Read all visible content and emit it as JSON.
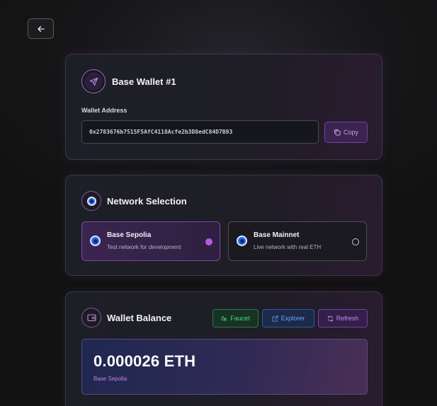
{
  "wallet": {
    "name": "Base Wallet #1",
    "address_label": "Wallet Address",
    "address": "0x2783676b7515F5AfC4118Acfe2b3D8edC84D7B93",
    "copy_label": "Copy"
  },
  "network": {
    "title": "Network Selection",
    "options": [
      {
        "name": "Base Sepolia",
        "description": "Test network for development",
        "selected": true
      },
      {
        "name": "Base Mainnet",
        "description": "Live network with real ETH",
        "selected": false
      }
    ]
  },
  "balance": {
    "title": "Wallet Balance",
    "faucet_label": "Faucet",
    "explorer_label": "Explorer",
    "refresh_label": "Refresh",
    "amount": "0.000026 ETH",
    "network": "Base Sepolia"
  },
  "icons": {
    "back": "arrow-left-icon",
    "wallet_avatar": "send-icon",
    "network": "radio-icon",
    "balance": "wallet-icon",
    "copy": "copy-icon",
    "faucet": "droplets-icon",
    "explorer": "external-link-icon",
    "refresh": "refresh-icon"
  },
  "colors": {
    "accent_purple": "#b45ae8",
    "faucet_green": "#4ed48a",
    "explorer_blue": "#6aa6ff",
    "radio_blue": "#2a6ae8"
  }
}
